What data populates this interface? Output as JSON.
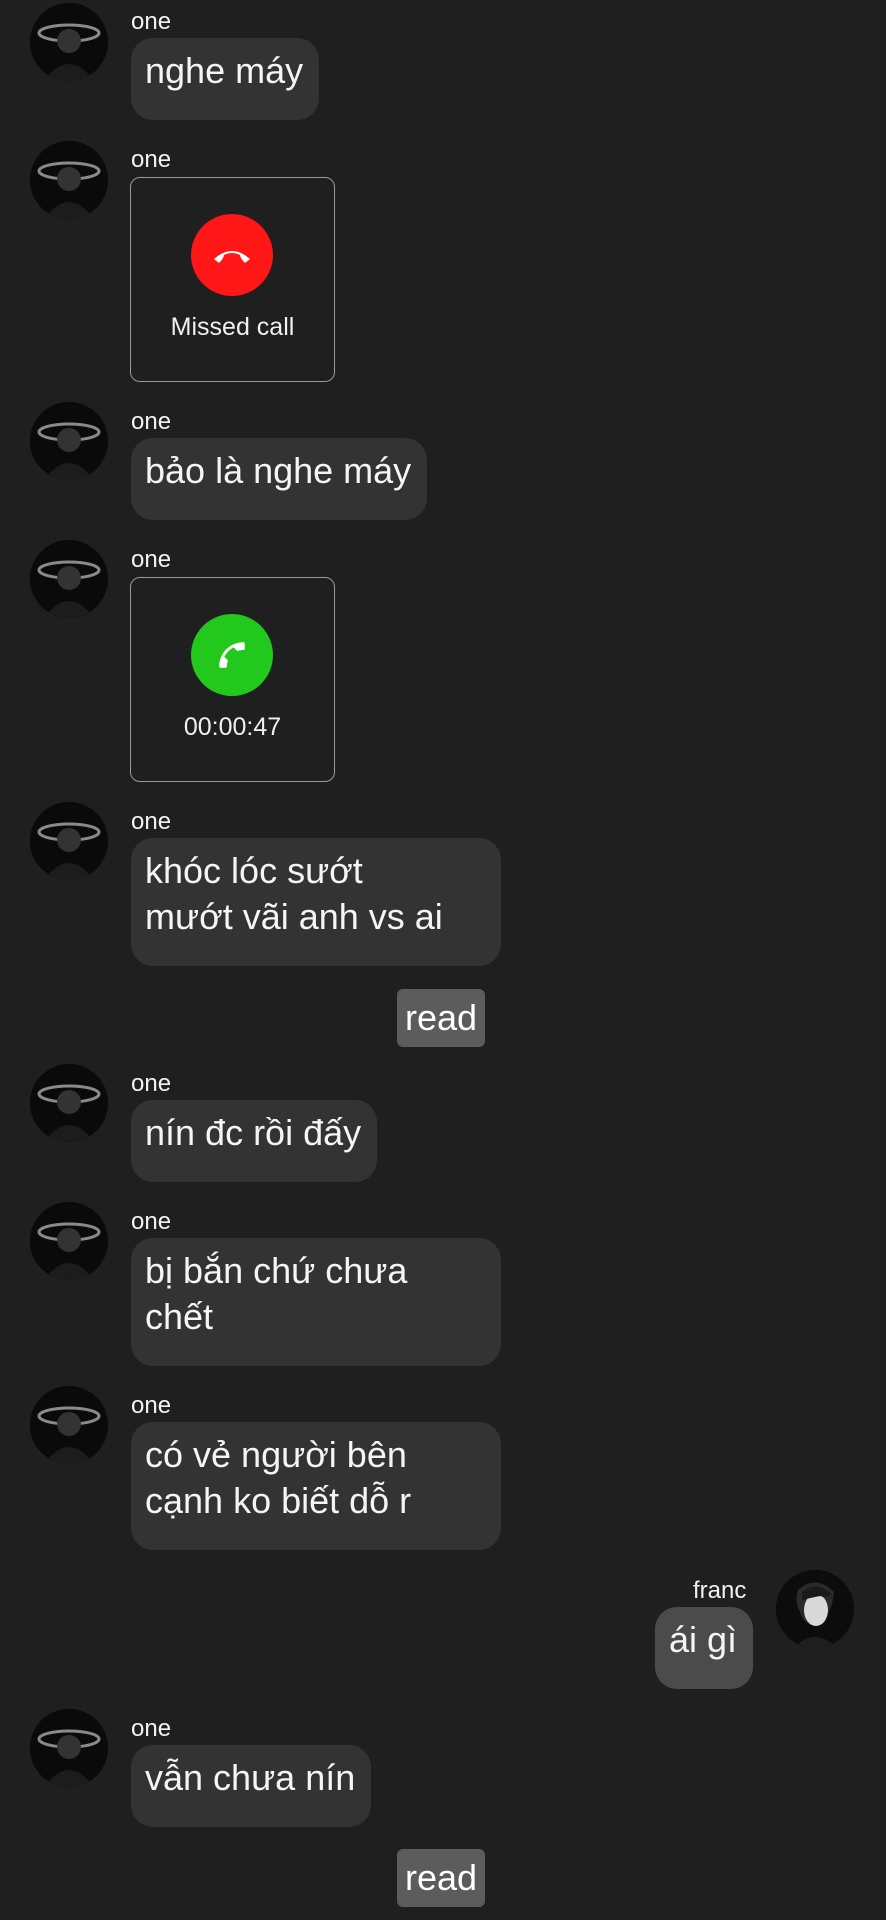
{
  "messages": [
    {
      "sender": "one",
      "type": "text",
      "text": "nghe máy"
    },
    {
      "sender": "one",
      "type": "call",
      "status": "Missed call",
      "color": "#ff1616"
    },
    {
      "sender": "one",
      "type": "text",
      "text": "bảo là nghe máy"
    },
    {
      "sender": "one",
      "type": "call",
      "status": "00:00:47",
      "color": "#22c91c"
    },
    {
      "sender": "one",
      "type": "text",
      "lines": [
        "khóc lóc sướt",
        "mướt vãi anh vs ai"
      ]
    },
    {
      "sender": "one",
      "type": "text",
      "text": "nín đc rồi đấy"
    },
    {
      "sender": "one",
      "type": "text",
      "lines": [
        "bị bắn chứ chưa",
        "chết"
      ]
    },
    {
      "sender": "one",
      "type": "text",
      "lines": [
        "có vẻ người bên",
        "cạnh ko biết dỗ r"
      ]
    },
    {
      "sender": "franc",
      "type": "text",
      "text": "ái gì"
    },
    {
      "sender": "one",
      "type": "text",
      "text": "vẫn chưa nín"
    }
  ],
  "read_receipts": [
    "read",
    "read"
  ],
  "colors": {
    "background": "#1f1f1f",
    "bubble": "#333333",
    "my_bubble": "#4b4b4b",
    "read_badge": "#5c5c5c"
  }
}
